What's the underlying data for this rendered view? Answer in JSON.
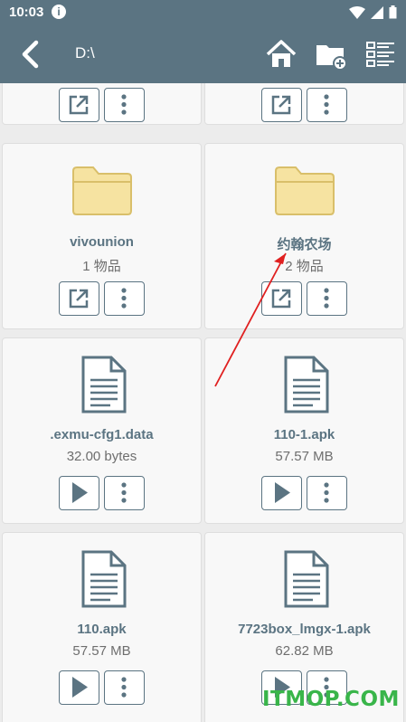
{
  "status_bar": {
    "time": "10:03",
    "info_icon": "i"
  },
  "app_bar": {
    "path": "D:\\",
    "icons": [
      "back-arrow-icon",
      "home-icon",
      "new-folder-icon",
      "list-view-icon"
    ]
  },
  "items": [
    {
      "name": "",
      "sub": "",
      "type": "folder"
    },
    {
      "name": "",
      "sub": "",
      "type": "folder"
    },
    {
      "name": "vivounion",
      "sub": "1 物品",
      "type": "folder"
    },
    {
      "name": "约翰农场",
      "sub": "2 物品",
      "type": "folder"
    },
    {
      "name": ".exmu-cfg1.data",
      "sub": "32.00 bytes",
      "type": "file"
    },
    {
      "name": "110-1.apk",
      "sub": "57.57 MB",
      "type": "file"
    },
    {
      "name": "110.apk",
      "sub": "57.57 MB",
      "type": "file"
    },
    {
      "name": "7723box_lmgx-1.apk",
      "sub": "62.82 MB",
      "type": "file"
    }
  ],
  "watermark": "ITMOP.COM",
  "colors": {
    "bar": "#5b7482",
    "folder": "#f6e3a1",
    "accent": "#5b7482",
    "arrow": "#e02020",
    "watermark": "#39b54a"
  }
}
